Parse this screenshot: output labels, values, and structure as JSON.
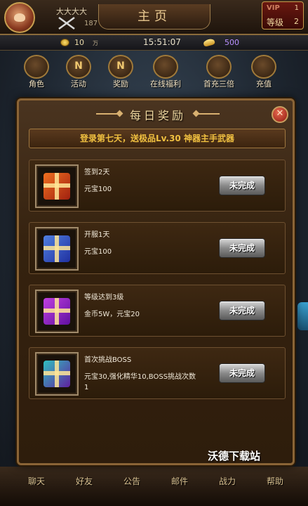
{
  "header": {
    "player_name": "大大大大",
    "power": "187",
    "title": "主页",
    "vip_label": "VIP",
    "vip_level": "1",
    "rank_label": "等级",
    "rank_level": "2"
  },
  "resources": {
    "coins": "10",
    "coins_unit": "万",
    "time": "15:51:07",
    "ingots": "500"
  },
  "nav": [
    {
      "label": "角色",
      "icon": "character-icon"
    },
    {
      "label": "活动",
      "icon": "activity-icon",
      "glyph": "N"
    },
    {
      "label": "奖励",
      "icon": "reward-icon",
      "glyph": "N"
    },
    {
      "label": "在线福利",
      "icon": "online-gift-icon"
    },
    {
      "label": "首充三倍",
      "icon": "gold-ingot-icon"
    },
    {
      "label": "充值",
      "icon": "treasure-chest-icon"
    }
  ],
  "dialog": {
    "title": "每日奖励",
    "banner": "登录第七天，送极品Lv.30 神器主手武器",
    "tasks": [
      {
        "name": "签到2天",
        "reward": "元宝100",
        "button": "未完成",
        "icon": "red-gift-icon"
      },
      {
        "name": "开服1天",
        "reward": "元宝100",
        "button": "未完成",
        "icon": "blue-gift-icon"
      },
      {
        "name": "等级达到3级",
        "reward": "金币5W，元宝20",
        "button": "未完成",
        "icon": "purple-gift-icon"
      },
      {
        "name": "首次挑战BOSS",
        "reward": "元宝30,强化精华10,BOSS挑战次数1",
        "button": "未完成",
        "icon": "teal-gift-icon"
      }
    ]
  },
  "bottom_nav": [
    "聊天",
    "好友",
    "公告",
    "邮件",
    "战力",
    "帮助"
  ],
  "watermark": "沃德下载站"
}
